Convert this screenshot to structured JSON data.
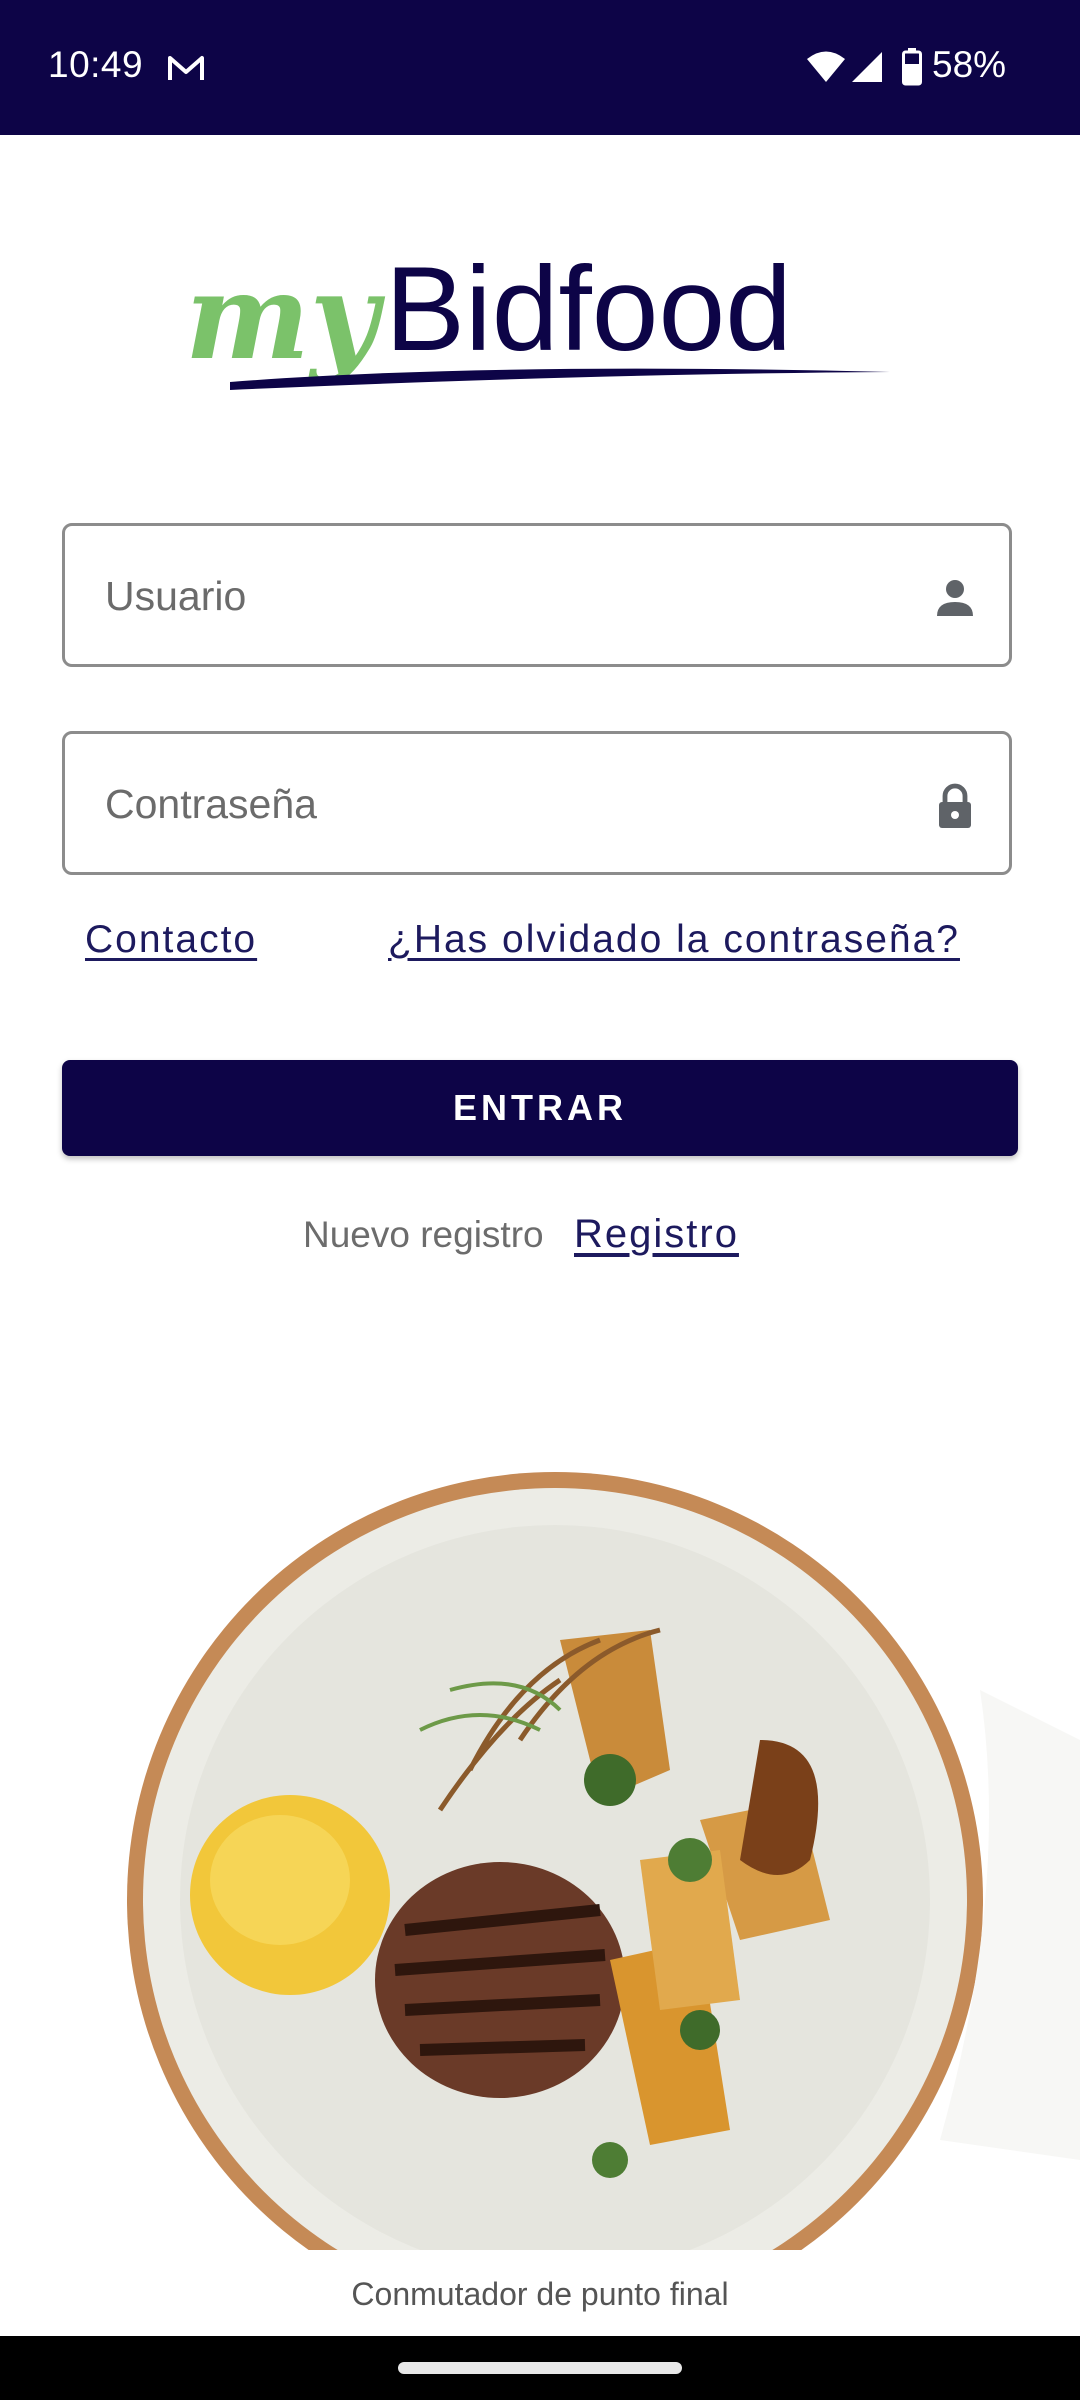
{
  "status_bar": {
    "time": "10:49",
    "battery": "58%",
    "icons": [
      "gmail-icon",
      "wifi-icon",
      "signal-icon",
      "battery-icon"
    ]
  },
  "logo": {
    "part1": "my",
    "part2": "Bidfood"
  },
  "login": {
    "username_placeholder": "Usuario",
    "password_placeholder": "Contraseña",
    "contact_link": "Contacto",
    "forgot_link": "¿Has olvidado la contraseña?",
    "submit_label": "ENTRAR",
    "new_register_text": "Nuevo registro",
    "register_link": "Registro"
  },
  "footer": {
    "endpoint_switcher": "Conmutador de punto final"
  },
  "colors": {
    "primary": "#0d0447",
    "logo_green": "#7bc26a",
    "link": "#1d1a5e"
  }
}
